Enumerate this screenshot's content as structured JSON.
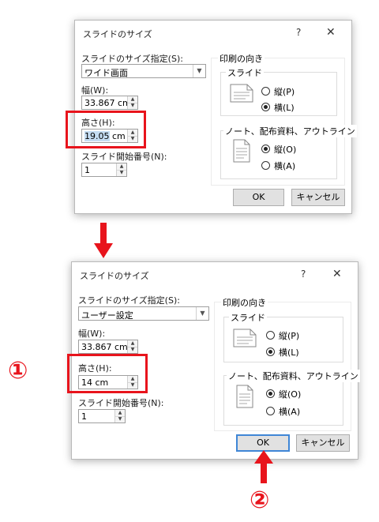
{
  "dialog1": {
    "title": "スライドのサイズ",
    "help": "?",
    "close": "✕",
    "size_label": "スライドのサイズ指定(S):",
    "size_value": "ワイド画面",
    "width_label": "幅(W):",
    "width_value": "33.867 cm",
    "height_label": "高さ(H):",
    "height_value_selected": "19.05",
    "height_value_rest": " cm",
    "start_label": "スライド開始番号(N):",
    "start_value": "1",
    "orient_title": "印刷の向き",
    "slide_group": "スライド",
    "slide_portrait": "縦(P)",
    "slide_landscape": "横(L)",
    "notes_group": "ノート、配布資料、アウトライン",
    "notes_portrait": "縦(O)",
    "notes_landscape": "横(A)",
    "ok": "OK",
    "cancel": "キャンセル"
  },
  "dialog2": {
    "title": "スライドのサイズ",
    "help": "?",
    "close": "✕",
    "size_label": "スライドのサイズ指定(S):",
    "size_value": "ユーザー設定",
    "width_label": "幅(W):",
    "width_value": "33.867 cm",
    "height_label": "高さ(H):",
    "height_value": "14 cm",
    "start_label": "スライド開始番号(N):",
    "start_value": "1",
    "orient_title": "印刷の向き",
    "slide_group": "スライド",
    "slide_portrait": "縦(P)",
    "slide_landscape": "横(L)",
    "notes_group": "ノート、配布資料、アウトライン",
    "notes_portrait": "縦(O)",
    "notes_landscape": "横(A)",
    "ok": "OK",
    "cancel": "キャンセル"
  },
  "annotations": {
    "step1": "①",
    "step2": "②",
    "accent_color": "#e8141c",
    "arrow_down_icon": "arrow-down-icon",
    "arrow_up_icon": "arrow-up-icon"
  }
}
